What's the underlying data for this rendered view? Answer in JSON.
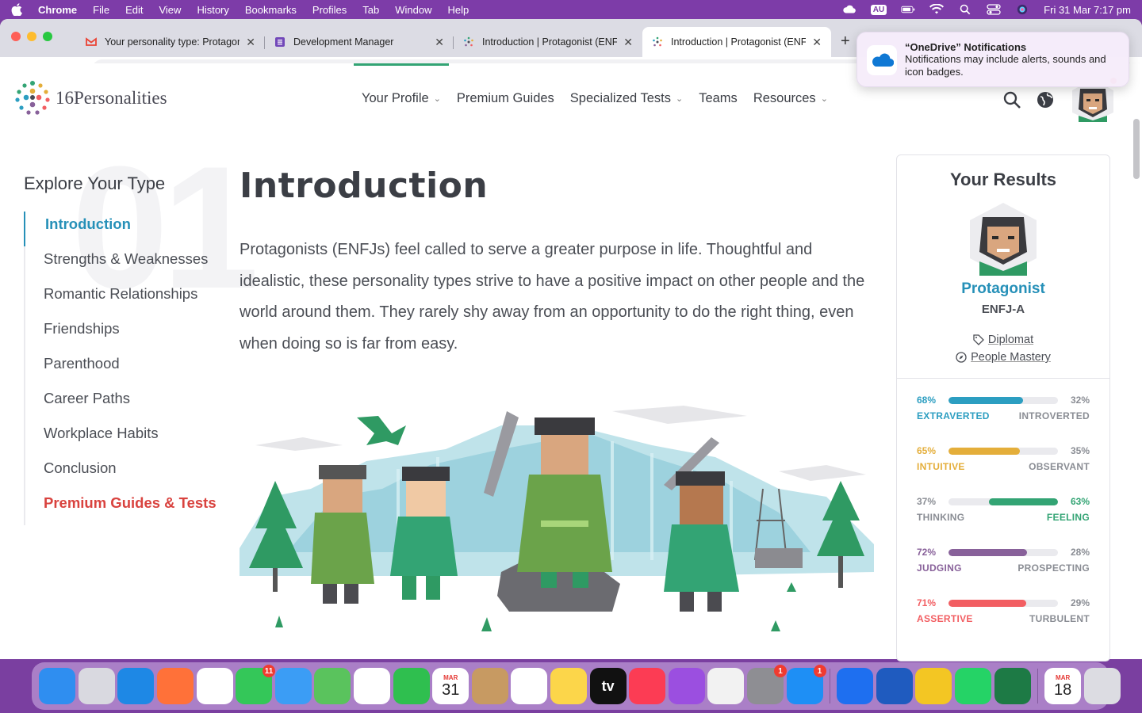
{
  "menubar": {
    "app": "Chrome",
    "items": [
      "File",
      "Edit",
      "View",
      "History",
      "Bookmarks",
      "Profiles",
      "Tab",
      "Window",
      "Help"
    ],
    "clock": "Fri 31 Mar  7:17 pm",
    "input_source": "AU"
  },
  "tabs": [
    {
      "title": "Your personality type: Protagonist",
      "icon": "gmail-icon"
    },
    {
      "title": "Development Manager",
      "icon": "forms-icon"
    },
    {
      "title": "Introduction | Protagonist (ENFJ)",
      "icon": "16p-icon"
    },
    {
      "title": "Introduction | Protagonist (ENFJ)",
      "icon": "16p-icon"
    }
  ],
  "omnibox": {
    "value": "#"
  },
  "notification": {
    "title": "“OneDrive” Notifications",
    "body": "Notifications may include alerts, sounds and icon badges."
  },
  "site": {
    "logo_text": "16Personalities",
    "nav": [
      {
        "label": "Your Profile",
        "dropdown": true
      },
      {
        "label": "Premium Guides",
        "dropdown": false
      },
      {
        "label": "Specialized Tests",
        "dropdown": true
      },
      {
        "label": "Teams",
        "dropdown": false
      },
      {
        "label": "Resources",
        "dropdown": true
      }
    ]
  },
  "sidebar": {
    "heading": "Explore Your Type",
    "section_number": "01",
    "items": [
      {
        "label": "Introduction",
        "state": "active"
      },
      {
        "label": "Strengths & Weaknesses",
        "state": "normal"
      },
      {
        "label": "Romantic Relationships",
        "state": "normal"
      },
      {
        "label": "Friendships",
        "state": "normal"
      },
      {
        "label": "Parenthood",
        "state": "normal"
      },
      {
        "label": "Career Paths",
        "state": "normal"
      },
      {
        "label": "Workplace Habits",
        "state": "normal"
      },
      {
        "label": "Conclusion",
        "state": "normal"
      },
      {
        "label": "Premium Guides & Tests",
        "state": "premium"
      }
    ]
  },
  "article": {
    "title": "Introduction",
    "paragraph": "Protagonists (ENFJs) feel called to serve a greater purpose in life. Thoughtful and idealistic, these personality types strive to have a positive impact on other people and the world around them. They rarely shy away from an opportunity to do the right thing, even when doing so is far from easy."
  },
  "results": {
    "heading": "Your Results",
    "type_name": "Protagonist",
    "type_code": "ENFJ-A",
    "role": "Diplomat",
    "strategy": "People Mastery",
    "traits": [
      {
        "left_pct": "68%",
        "right_pct": "32%",
        "left_label": "EXTRAVERTED",
        "right_label": "INTROVERTED",
        "value": 0.68,
        "side": "left",
        "color": "#2c9ec1"
      },
      {
        "left_pct": "65%",
        "right_pct": "35%",
        "left_label": "INTUITIVE",
        "right_label": "OBSERVANT",
        "value": 0.65,
        "side": "left",
        "color": "#e4ae3a"
      },
      {
        "left_pct": "37%",
        "right_pct": "63%",
        "left_label": "THINKING",
        "right_label": "FEELING",
        "value": 0.63,
        "side": "right",
        "color": "#33a474"
      },
      {
        "left_pct": "72%",
        "right_pct": "28%",
        "left_label": "JUDGING",
        "right_label": "PROSPECTING",
        "value": 0.72,
        "side": "left",
        "color": "#88619a"
      },
      {
        "left_pct": "71%",
        "right_pct": "29%",
        "left_label": "ASSERTIVE",
        "right_label": "TURBULENT",
        "value": 0.71,
        "side": "left",
        "color": "#f25e62"
      }
    ]
  },
  "dock": {
    "apps": [
      {
        "name": "finder",
        "color": "#2f8ef0"
      },
      {
        "name": "launchpad",
        "color": "#d9d9e0"
      },
      {
        "name": "safari",
        "color": "#1e88e5"
      },
      {
        "name": "firefox",
        "color": "#ff7139"
      },
      {
        "name": "chrome",
        "color": "#ffffff"
      },
      {
        "name": "messages",
        "color": "#34c759",
        "badge": "11"
      },
      {
        "name": "mail",
        "color": "#3b9df5"
      },
      {
        "name": "maps",
        "color": "#5ac35d"
      },
      {
        "name": "photos",
        "color": "#ffffff"
      },
      {
        "name": "facetime",
        "color": "#2fbf4f"
      },
      {
        "name": "calendar",
        "color": "#ffffff",
        "month": "MAR",
        "day": "31"
      },
      {
        "name": "contacts",
        "color": "#c79a62"
      },
      {
        "name": "reminders",
        "color": "#ffffff"
      },
      {
        "name": "notes",
        "color": "#fcd64a"
      },
      {
        "name": "apple-tv",
        "color": "#111111",
        "text": "tv"
      },
      {
        "name": "music",
        "color": "#fc3c54"
      },
      {
        "name": "podcasts",
        "color": "#9b4fe0"
      },
      {
        "name": "news",
        "color": "#f2f2f2"
      },
      {
        "name": "system-settings",
        "color": "#8e8e93",
        "badge": "1"
      },
      {
        "name": "app-store",
        "color": "#1e8ff5",
        "badge": "1"
      },
      {
        "name": "bluetooth",
        "color": "#1e6ff0"
      },
      {
        "name": "word",
        "color": "#1f5bbf"
      },
      {
        "name": "chrome-canary",
        "color": "#f3c623"
      },
      {
        "name": "whatsapp",
        "color": "#25d366"
      },
      {
        "name": "excel",
        "color": "#1d7a45"
      },
      {
        "name": "calendar-doc",
        "color": "#ffffff",
        "month": "MAR",
        "day": "18"
      },
      {
        "name": "trash",
        "color": "#dcdce2"
      }
    ]
  }
}
